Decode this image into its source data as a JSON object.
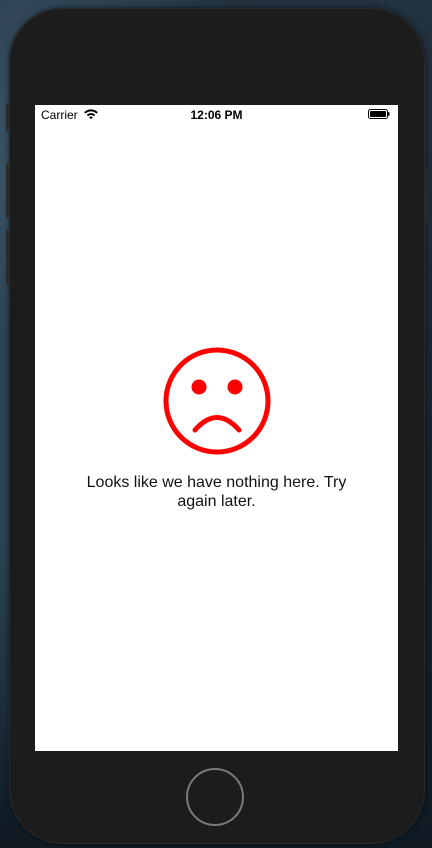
{
  "status_bar": {
    "carrier": "Carrier",
    "time": "12:06 PM",
    "wifi_icon": "wifi-icon",
    "battery_icon": "battery-icon"
  },
  "empty_state": {
    "icon": "sad-face-icon",
    "icon_color": "#ff0000",
    "message": "Looks like we have nothing here. Try again later."
  },
  "device": {
    "home_button_icon": "home-button"
  }
}
